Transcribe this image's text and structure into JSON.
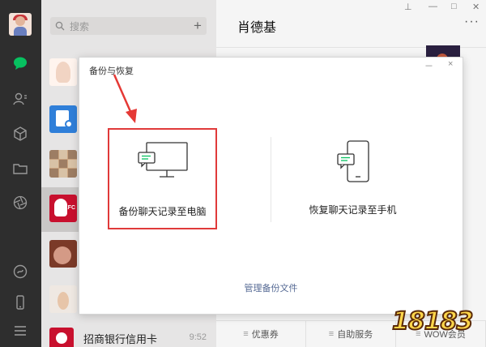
{
  "sidebar": {
    "icons": [
      "chat-icon",
      "contacts-icon",
      "favorites-icon",
      "folder-icon",
      "moments-icon",
      "mini-program-icon",
      "phone-icon",
      "menu-icon"
    ],
    "active_color": "#07c160"
  },
  "chat_list": {
    "search_placeholder": "搜索",
    "add_label": "+",
    "last_item": {
      "name": "招商银行信用卡",
      "time": "9:52"
    }
  },
  "chat": {
    "title": "肖德基",
    "more_label": "···",
    "bottom_menus": [
      {
        "icon": "≡",
        "label": "优惠券"
      },
      {
        "icon": "≡",
        "label": "自助服务"
      },
      {
        "icon": "≡",
        "label": "WOW会员"
      }
    ]
  },
  "dialog": {
    "title": "备份与恢复",
    "minimize": "－",
    "close": "×",
    "backup_label": "备份聊天记录至电脑",
    "restore_label": "恢复聊天记录至手机",
    "manage_label": "管理备份文件",
    "highlight_color": "#e03a3a"
  },
  "watermark": {
    "text": "18183"
  }
}
